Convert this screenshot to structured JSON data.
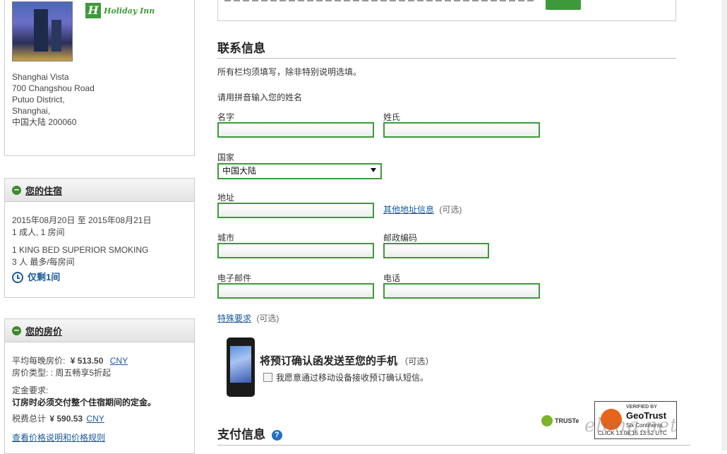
{
  "hotel": {
    "brand": "Holiday Inn",
    "address_lines": [
      "Shanghai Vista",
      "700 Changshou Road",
      "Putuo District,",
      "Shanghai,",
      "中国大陆   200060"
    ]
  },
  "stay": {
    "title": "您的住宿",
    "dates": "2015年08月20日  至  2015年08月21日",
    "guests": "1 成人, 1 房间",
    "room": "1 KING BED SUPERIOR SMOKING",
    "max": "3 人 最多/每房间",
    "left": "仅剩1间"
  },
  "price": {
    "title": "您的房价",
    "avg_label": "平均每晚房价:",
    "avg_value": "¥ 513.50",
    "currency": "CNY",
    "type_label": "房价类型:",
    "type_value": ": 周五畅享5折起",
    "deposit_label": "定金要求:",
    "deposit_text": "订房时必须交付整个住宿期间的定金。",
    "total_label": "税费总计",
    "total_value": "¥ 590.53",
    "total_currency": "CNY",
    "link": "查看价格说明和价格规则"
  },
  "contact": {
    "heading": "联系信息",
    "note": "所有栏均须填写，除非特别说明选填。",
    "pinyin_note": "请用拼音输入您的姓名",
    "first_name": "名字",
    "last_name": "姓氏",
    "country": "国家",
    "country_value": "中国大陆",
    "address": "地址",
    "other_address": "其他地址信息",
    "optional": "(可选)",
    "city": "城市",
    "postcode": "邮政编码",
    "email": "电子邮件",
    "phone": "电话",
    "special": "特殊要求"
  },
  "mobile": {
    "heading": "将预订确认函发送至您的手机",
    "optional": "（可选）",
    "checkbox": "我愿意通过移动设备接收预订确认短信。"
  },
  "trust": {
    "truste": "TRUSTe",
    "geo_verified": "VERIFIED BY",
    "geo_name": "GeoTrust",
    "geo_sub": "Six Continents",
    "geo_click": "CLICK  13.08.15  13:52  UTC"
  },
  "payment": {
    "heading": "支付信息",
    "help": "?"
  },
  "watermark": "elong.net",
  "colors": {
    "accent": "#3d9a3a",
    "link": "#1a5a99"
  }
}
